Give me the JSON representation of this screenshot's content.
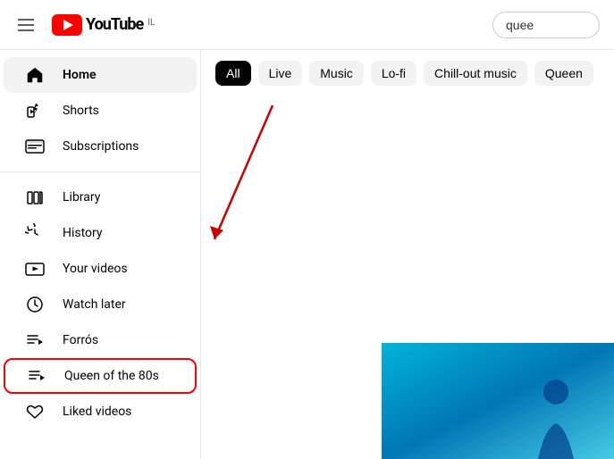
{
  "header": {
    "menu_label": "Menu",
    "logo_text": "YouTube",
    "logo_country": "IL",
    "search_value": "quee"
  },
  "sidebar": {
    "items": [
      {
        "id": "home",
        "label": "Home",
        "icon": "home",
        "active": true,
        "highlighted": false
      },
      {
        "id": "shorts",
        "label": "Shorts",
        "icon": "shorts",
        "active": false,
        "highlighted": false
      },
      {
        "id": "subscriptions",
        "label": "Subscriptions",
        "icon": "subscriptions",
        "active": false,
        "highlighted": false
      },
      {
        "id": "library",
        "label": "Library",
        "icon": "library",
        "active": false,
        "highlighted": false
      },
      {
        "id": "history",
        "label": "History",
        "icon": "history",
        "active": false,
        "highlighted": false
      },
      {
        "id": "your-videos",
        "label": "Your videos",
        "icon": "your-videos",
        "active": false,
        "highlighted": false
      },
      {
        "id": "watch-later",
        "label": "Watch later",
        "icon": "watch-later",
        "active": false,
        "highlighted": false
      },
      {
        "id": "forros",
        "label": "Forrós",
        "icon": "playlist",
        "active": false,
        "highlighted": false
      },
      {
        "id": "queen-80s",
        "label": "Queen of the 80s",
        "icon": "playlist",
        "active": false,
        "highlighted": true
      },
      {
        "id": "liked-videos",
        "label": "Liked videos",
        "icon": "liked",
        "active": false,
        "highlighted": false
      }
    ]
  },
  "filter_bar": {
    "chips": [
      {
        "id": "all",
        "label": "All",
        "active": true
      },
      {
        "id": "live",
        "label": "Live",
        "active": false
      },
      {
        "id": "music",
        "label": "Music",
        "active": false
      },
      {
        "id": "lofi",
        "label": "Lo-fi",
        "active": false
      },
      {
        "id": "chill",
        "label": "Chill-out music",
        "active": false
      },
      {
        "id": "queen",
        "label": "Queen",
        "active": false
      }
    ]
  }
}
